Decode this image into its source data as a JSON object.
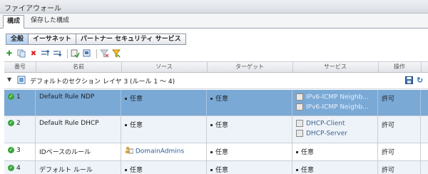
{
  "window": {
    "title": "ファイアウォール"
  },
  "tabs": [
    {
      "label": "構成"
    },
    {
      "label": "保存した構成"
    }
  ],
  "subtabs": [
    {
      "label": "全般"
    },
    {
      "label": "イーサネット"
    },
    {
      "label": "パートナー セキュリティ サービス"
    }
  ],
  "toolbar": {
    "icons": [
      "add-icon",
      "copy-icon",
      "delete-icon",
      "move-up-icon",
      "move-down-icon",
      "apply-icon",
      "revert-icon",
      "clear-filter-icon",
      "filter-icon"
    ]
  },
  "columns": {
    "number": "番号",
    "name": "名前",
    "source": "ソース",
    "target": "ターゲット",
    "service": "サービス",
    "action": "操作"
  },
  "section": {
    "title": "デフォルトのセクション レイヤ 3 (ルール 1 ～ 4)"
  },
  "rules": [
    {
      "number": "1",
      "name": "Default Rule NDP",
      "source": "任意",
      "target": "任意",
      "services": [
        "IPv6-ICMP Neighb...",
        "IPv6-ICMP Neighb..."
      ],
      "action": "許可"
    },
    {
      "number": "2",
      "name": "Default Rule DHCP",
      "source": "任意",
      "target": "任意",
      "services": [
        "DHCP-Client",
        "DHCP-Server"
      ],
      "action": "許可"
    },
    {
      "number": "3",
      "name": "IDベースのルール",
      "source": "DomainAdmins",
      "target": "任意",
      "services": [
        "任意"
      ],
      "action": "許可"
    },
    {
      "number": "4",
      "name": "デフォルト ルール",
      "source": "任意",
      "target": "任意",
      "services": [
        "任意"
      ],
      "action": "許可"
    }
  ],
  "colors": {
    "selected_row": "#7aa9d6",
    "alt_row": "#eef3f9",
    "enabled_check": "#3aa53a"
  }
}
